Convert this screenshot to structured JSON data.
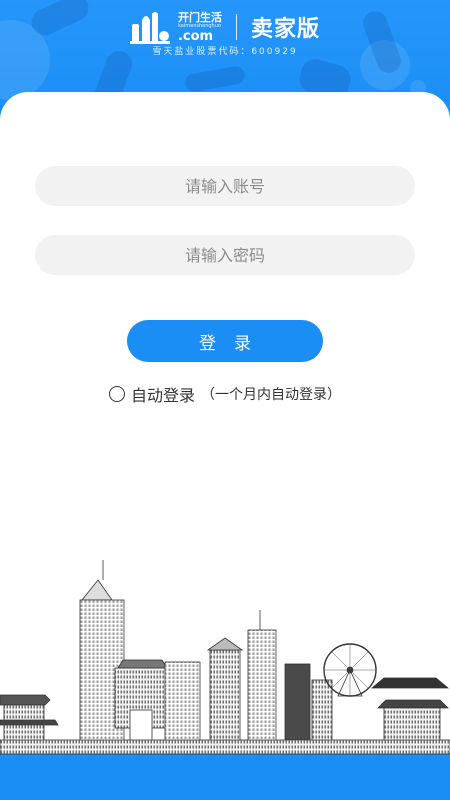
{
  "header": {
    "logo_cn": "开门生活",
    "logo_en": "kaimenshenghuo",
    "logo_com": ".com",
    "title": "卖家版",
    "stock_line": "雪天盐业股票代码：600929"
  },
  "form": {
    "account_placeholder": "请输入账号",
    "password_placeholder": "请输入密码",
    "login_label": "登录",
    "remember_label": "自动登录",
    "remember_hint": "（一个月内自动登录）"
  },
  "colors": {
    "brand": "#1a8ef5",
    "field_bg": "#f2f2f2"
  },
  "icons": [
    "logo-icon",
    "radio-icon",
    "city-skyline-illustration"
  ]
}
